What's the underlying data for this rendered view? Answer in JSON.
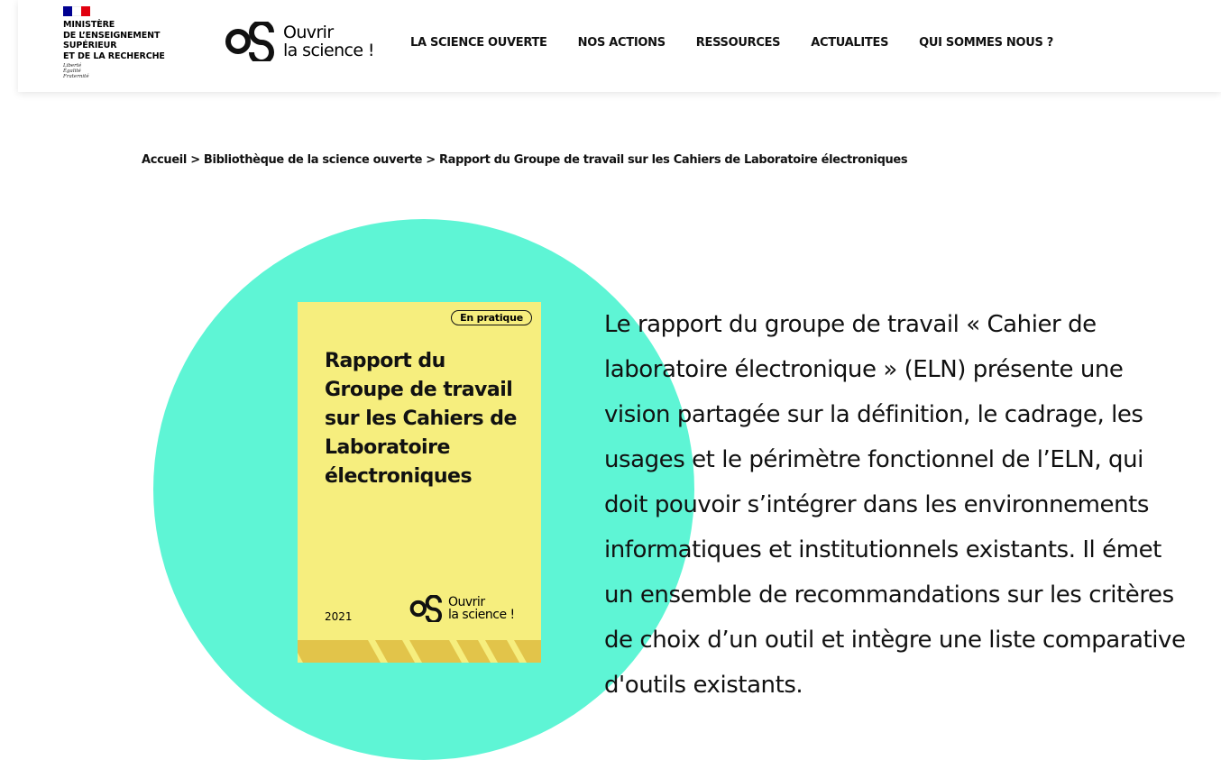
{
  "header": {
    "ministry": {
      "lines": [
        "MINISTÈRE",
        "DE L’ENSEIGNEMENT",
        "SUPÉRIEUR",
        "ET DE LA RECHERCHE"
      ],
      "motto": [
        "Liberté",
        "Égalité",
        "Fraternité"
      ],
      "flag_colors": [
        "#000091",
        "#ffffff",
        "#e1000f"
      ]
    },
    "logo": {
      "line1": "Ouvrir",
      "line2": "la science !"
    },
    "nav": [
      {
        "label": "LA SCIENCE OUVERTE"
      },
      {
        "label": "NOS ACTIONS"
      },
      {
        "label": "RESSOURCES"
      },
      {
        "label": "ACTUALITES"
      },
      {
        "label": "QUI SOMMES NOUS ?"
      }
    ]
  },
  "breadcrumb": {
    "items": [
      {
        "label": "Accueil"
      },
      {
        "label": "Bibliothèque de la science ouverte"
      },
      {
        "label": "Rapport du Groupe de travail sur les Cahiers de Laboratoire électroniques"
      }
    ],
    "separator": ">"
  },
  "cover": {
    "tag": "En pratique",
    "title_lines": [
      "Rapport du",
      "Groupe de travail",
      "sur les Cahiers de",
      "Laboratoire",
      "électroniques"
    ],
    "year": "2021",
    "logo": {
      "line1": "Ouvrir",
      "line2": "la science !"
    }
  },
  "description": "Le rapport du groupe de travail « Cahier de laboratoire électronique » (ELN) présente une vision partagée sur la définition, le cadrage, les usages et le périmètre fonctionnel de l’ELN, qui doit pouvoir s’intégrer dans les environnements informatiques et institutionnels existants. Il émet un ensemble de recommandations sur les critères de choix d’un outil et intègre une liste comparative d'outils existants.",
  "colors": {
    "circle": "#5ef5d5",
    "cover_bg": "#f6ee7e",
    "cover_band": "#e2c44a"
  }
}
